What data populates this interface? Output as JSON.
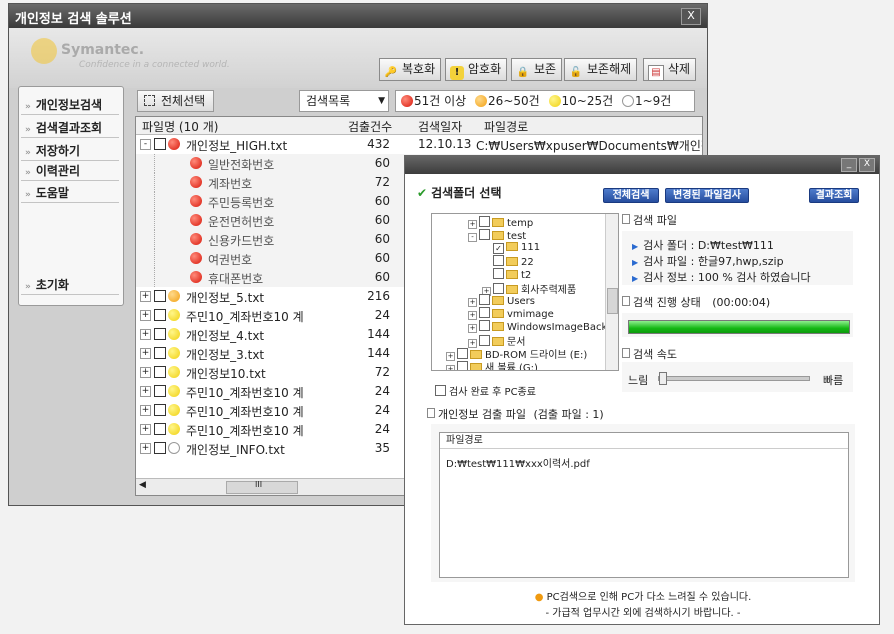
{
  "main_window": {
    "title": "개인정보 검색 솔루션",
    "close_label": "X",
    "logo_text": "Symantec.",
    "logo_sub": "Confidence in a connected world.",
    "toolbar": [
      {
        "label": "복호화",
        "icon": "key-icon"
      },
      {
        "label": "암호화",
        "icon": "shield-icon"
      },
      {
        "label": "보존",
        "icon": "lock-icon"
      },
      {
        "label": "보존해제",
        "icon": "unlock-icon"
      },
      {
        "label": "삭제",
        "icon": "delete-icon"
      }
    ],
    "nav": [
      "개인정보검색",
      "검색결과조회",
      "저장하기",
      "이력관리",
      "도움말",
      "초기화"
    ],
    "select_all": "전체선택",
    "dropdown_value": "검색목록",
    "legend": [
      {
        "color": "red",
        "label": "51건 이상"
      },
      {
        "color": "orange",
        "label": "26~50건"
      },
      {
        "color": "yellow",
        "label": "10~25건"
      },
      {
        "color": "white",
        "label": "1~9건"
      }
    ],
    "grid_headers": {
      "name": "파일명 (10 개)",
      "count": "검출건수",
      "date": "검색일자",
      "path": "파일경로"
    },
    "rows": [
      {
        "type": "parent",
        "expand": "-",
        "color": "red",
        "name": "개인정보_HIGH.txt",
        "count": "432",
        "date": "12.10.13",
        "path": "C:₩Users₩xpuser₩Documents₩개인정보"
      },
      {
        "type": "child",
        "color": "red",
        "name": "일반전화번호",
        "count": "60"
      },
      {
        "type": "child",
        "color": "red",
        "name": "계좌번호",
        "count": "72"
      },
      {
        "type": "child",
        "color": "red",
        "name": "주민등록번호",
        "count": "60"
      },
      {
        "type": "child",
        "color": "red",
        "name": "운전면허번호",
        "count": "60"
      },
      {
        "type": "child",
        "color": "red",
        "name": "신용카드번호",
        "count": "60"
      },
      {
        "type": "child",
        "color": "red",
        "name": "여권번호",
        "count": "60"
      },
      {
        "type": "child",
        "color": "red",
        "name": "휴대폰번호",
        "count": "60"
      },
      {
        "type": "parent",
        "expand": "+",
        "color": "orange",
        "name": "개인정보_5.txt",
        "count": "216"
      },
      {
        "type": "parent",
        "expand": "+",
        "color": "yellow",
        "name": "주민10_계좌번호10 계",
        "count": "24"
      },
      {
        "type": "parent",
        "expand": "+",
        "color": "yellow",
        "name": "개인정보_4.txt",
        "count": "144"
      },
      {
        "type": "parent",
        "expand": "+",
        "color": "yellow",
        "name": "개인정보_3.txt",
        "count": "144"
      },
      {
        "type": "parent",
        "expand": "+",
        "color": "yellow",
        "name": "개인정보10.txt",
        "count": "72"
      },
      {
        "type": "parent",
        "expand": "+",
        "color": "yellow",
        "name": "주민10_계좌번호10 계",
        "count": "24"
      },
      {
        "type": "parent",
        "expand": "+",
        "color": "yellow",
        "name": "주민10_계좌번호10 계",
        "count": "24"
      },
      {
        "type": "parent",
        "expand": "+",
        "color": "yellow",
        "name": "주민10_계좌번호10 계",
        "count": "24"
      },
      {
        "type": "parent",
        "expand": "+",
        "color": "white",
        "name": "개인정보_INFO.txt",
        "count": "35"
      }
    ],
    "scroll_grip": "III"
  },
  "dialog": {
    "min_label": "_",
    "close_label": "X",
    "heading": "검색폴더 선택",
    "buttons": [
      "전체검색",
      "변경된 파일검사",
      "결과조회"
    ],
    "tree": [
      {
        "expand": "+",
        "check": "",
        "label": "temp"
      },
      {
        "expand": "-",
        "check": "",
        "label": "test"
      },
      {
        "expand": "",
        "check": "✓",
        "label": "111"
      },
      {
        "expand": "",
        "check": "",
        "label": "22"
      },
      {
        "expand": "",
        "check": "",
        "label": "t2"
      },
      {
        "expand": "+",
        "check": "",
        "label": "회사주력제품"
      },
      {
        "expand": "+",
        "check": "",
        "label": "Users"
      },
      {
        "expand": "+",
        "check": "",
        "label": "vmimage"
      },
      {
        "expand": "+",
        "check": "",
        "label": "WindowsImageBackup"
      },
      {
        "expand": "+",
        "check": "",
        "label": "문서"
      },
      {
        "expand": "+",
        "check": "",
        "label": "BD-ROM 드라이브 (E:)"
      },
      {
        "expand": "+",
        "check": "",
        "label": "새 볼륨 (G:)"
      }
    ],
    "search_file_label": "검색 파일",
    "info": [
      "검사 폴더 : D:₩test₩111",
      "검사 파일 : 한글97,hwp,szip",
      "검사 정보 : 100 % 검사 하였습니다"
    ],
    "progress_label": "검색 진행 상태",
    "progress_time": "(00:00:04)",
    "progress_value": 1.0,
    "speed_label": "검색 속도",
    "speed_slow": "느림",
    "speed_fast": "빠름",
    "speed_value": 0.0,
    "shutdown_label": "검사 완료 후 PC종료",
    "result_label": "개인정보 검출 파일",
    "result_count": "(검출 파일 : 1)",
    "result_header": "파일경로",
    "result_rows": [
      "D:₩test₩111₩xxx이력서.pdf"
    ],
    "notice1": "PC검색으로 인해 PC가 다소 느려질 수 있습니다.",
    "notice2": "- 가급적 업무시간 외에 검색하시기 바랍니다. -"
  }
}
